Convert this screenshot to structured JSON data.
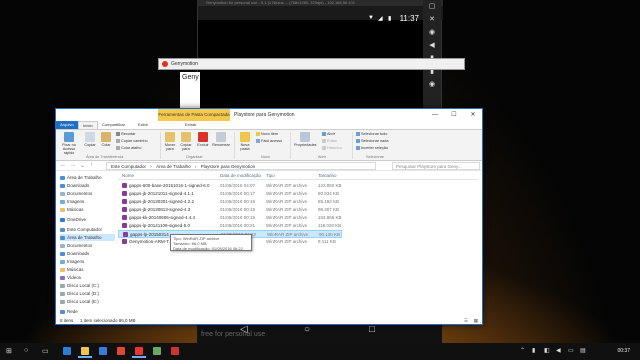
{
  "emulator": {
    "title_bar_text": "Genymotion for personal use - 5.1 (1 Nexus ... (768x1280, 320dpi) - 192.168.56.101",
    "clock": "11:37",
    "watermark": "free for personal use",
    "side_buttons": [
      "▢",
      "✕",
      "◉",
      "◀",
      "▮",
      "▮",
      "◉"
    ],
    "nav": {
      "back": "◁",
      "home": "○",
      "recent": "□"
    }
  },
  "genymotion_window": {
    "title": "Genymotion",
    "partial_text": "Geny"
  },
  "explorer": {
    "context_tab": "Ferramentas de Pasta Compactada",
    "window_title": "Playstore para Genymotion",
    "controls": {
      "minimize": "—",
      "maximize": "☐",
      "close": "✕"
    },
    "ribbon_tabs": [
      "Arquivo",
      "Início",
      "Compartilhar",
      "Exibir",
      "Extrair"
    ],
    "ribbon": {
      "pin_label": "Fixar no Acesso rápido",
      "copy_label": "Copiar",
      "paste_label": "Colar",
      "cut": "Recortar",
      "copy_path": "Copiar caminho",
      "paste_shortcut": "Colar atalho",
      "move_to": "Mover para",
      "copy_to": "Copiar para",
      "delete": "Excluir",
      "rename": "Renomear",
      "new_folder": "Nova pasta",
      "new_item": "Novo item",
      "easy_access": "Fácil acesso",
      "properties": "Propriedades",
      "open": "Abrir",
      "edit": "Editar",
      "history": "Histórico",
      "select_all": "Selecionar tudo",
      "select_none": "Selecionar nada",
      "invert_selection": "Inverter seleção",
      "groups": [
        "Área de Transferência",
        "Organizar",
        "Novo",
        "Abrir",
        "Selecionar"
      ]
    },
    "address": {
      "crumbs": [
        "Este Computador",
        "Área de Trabalho",
        "Playstore para Genymotion"
      ],
      "separator": "›",
      "search_placeholder": "Pesquisar Playstore para Geny..."
    },
    "nav_pane": [
      "Área de Trabalho",
      "Downloads",
      "Documentos",
      "Imagens",
      "Músicas",
      "OneDrive",
      "Este Computador",
      "Área de Trabalho",
      "Documentos",
      "Downloads",
      "Imagens",
      "Músicas",
      "Vídeos",
      "Disco Local (C:)",
      "Disco Local (D:)",
      "Disco Local (E:)",
      "Rede"
    ],
    "columns": {
      "name": "Nome",
      "date": "Data de modificação",
      "type": "Tipo",
      "size": "Tamanho"
    },
    "files": [
      {
        "name": "gapps-600-base-20151016-1-signed-6.0",
        "date": "01/05/2016 04:07",
        "type": "WinRAR ZIP archive",
        "size": "122.850 KB"
      },
      {
        "name": "gapps-jb-20121011-signed-4.1.1",
        "date": "01/05/2016 00:17",
        "type": "WinRAR ZIP archive",
        "size": "80.534 KB"
      },
      {
        "name": "gapps-jb-20130301-signed-4.2.2",
        "date": "01/05/2016 00:16",
        "type": "WinRAR ZIP archive",
        "size": "85.183 KB"
      },
      {
        "name": "gapps-jb-20130813-signed-4.3",
        "date": "01/05/2016 00:18",
        "type": "WinRAR ZIP archive",
        "size": "99.307 KB"
      },
      {
        "name": "gapps-kk-20140606-signed-4.4.4",
        "date": "01/05/2016 00:19",
        "type": "WinRAR ZIP archive",
        "size": "153.866 KB"
      },
      {
        "name": "gapps-lp-20141109-signed-5.0",
        "date": "01/05/2016 00:21",
        "type": "WinRAR ZIP archive",
        "size": "118.028 KB"
      },
      {
        "name": "gapps-lp-20150314",
        "date": "01/05/2016 06:22",
        "type": "WinRAR ZIP archive",
        "size": "90.130 KB"
      },
      {
        "name": "Genymotion-ARM-T...",
        "date": "",
        "type": "WinRAR ZIP archive",
        "size": "9.111 KB"
      }
    ],
    "tooltip": [
      "Tipo: WinRAR ZIP archive",
      "Tamanho: 86,0 MB",
      "Data de modificação: 01/05/2016 06:22"
    ],
    "status": {
      "count": "8 itens",
      "selected": "1 item selecionado 86,0 MB"
    }
  },
  "taskbar": {
    "clock": "00:37"
  }
}
